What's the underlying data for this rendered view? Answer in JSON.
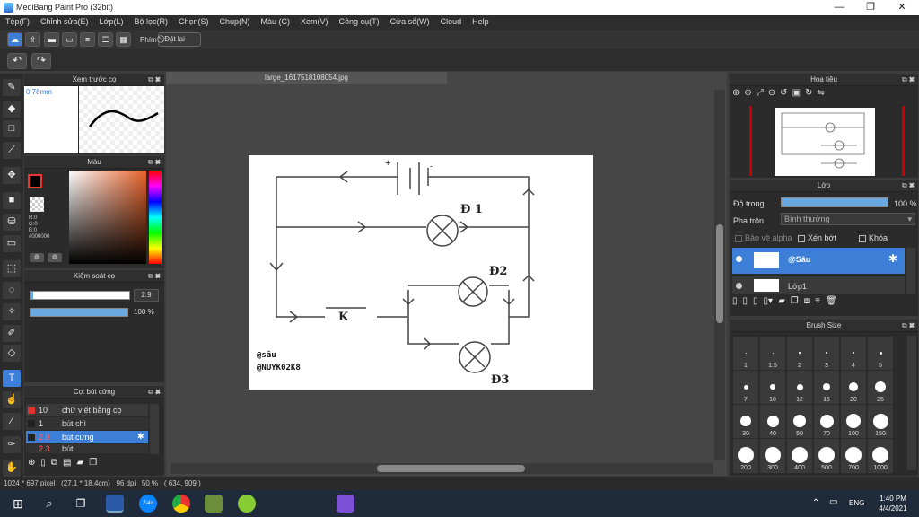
{
  "window": {
    "title": "MediBang Paint Pro (32bit)",
    "min": "—",
    "max": "❐",
    "close": "✕"
  },
  "menu": [
    "Tệp(F)",
    "Chỉnh sửa(E)",
    "Lớp(L)",
    "Bộ lọc(R)",
    "Chọn(S)",
    "Chụp(N)",
    "Màu (C)",
    "Xem(V)",
    "Công cụ(T)",
    "Cửa sổ(W)",
    "Cloud",
    "Help"
  ],
  "toolbar": {
    "phim_label": "Phím",
    "reset_label": "Đặt lại"
  },
  "panels": {
    "brush_preview": {
      "title": "Xem trước cọ",
      "size": "0.78mm"
    },
    "color": {
      "title": "Màu",
      "r": "R:0",
      "g": "G:0",
      "b": "B:0",
      "hex": "#000000"
    },
    "brush_control": {
      "title": "Kiểm soát cọ",
      "size_value": "2.9",
      "opacity_value": "100 %"
    },
    "brush_list": {
      "title": "Cọ: bút cứng",
      "items": [
        {
          "size": "10",
          "name": "chữ viết bằng cọ",
          "color": "#e03030"
        },
        {
          "size": "1",
          "name": "bút chì",
          "color": "#222222"
        },
        {
          "size": "2.9",
          "name": "bút cứng",
          "color": "#222222"
        },
        {
          "size": "2.3",
          "name": "bút",
          "color": "#222222"
        }
      ]
    },
    "navigator": {
      "title": "Hoa tiêu"
    },
    "layer": {
      "title": "Lớp",
      "opacity_label": "Độ trong",
      "opacity_value": "100 %",
      "blend_label": "Pha trộn",
      "blend_value": "Bình thường",
      "alpha_label": "Bảo vệ alpha",
      "clip_label": "Xén bớt",
      "lock_label": "Khóa",
      "layers": [
        {
          "name": "@Sâu"
        },
        {
          "name": "Lớp1"
        }
      ]
    },
    "brush_size": {
      "title": "Brush Size",
      "sizes": [
        "1",
        "1.5",
        "2",
        "3",
        "4",
        "5",
        "7",
        "10",
        "12",
        "15",
        "20",
        "25",
        "30",
        "40",
        "50",
        "70",
        "100",
        "150",
        "200",
        "300",
        "400",
        "500",
        "700",
        "1000"
      ]
    }
  },
  "document": {
    "tab": "large_1617518108054.jpg",
    "labels": {
      "d1": "Đ 1",
      "d2": "Đ2",
      "d3": "Đ3",
      "k": "K",
      "sign1": "@sâu",
      "sign2": "@NUYK02K8"
    }
  },
  "status": {
    "dims": "1024 * 697 pixel",
    "size": "(27.1 * 18.4cm)",
    "dpi": "96 dpi",
    "zoom": "50 %",
    "coords": "( 634, 909 )"
  },
  "taskbar": {
    "lang": "ENG",
    "time": "1:40 PM",
    "date": "4/4/2021"
  }
}
